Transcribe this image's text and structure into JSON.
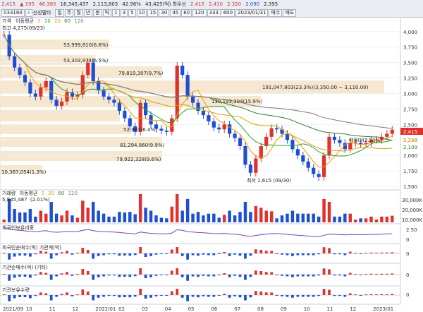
{
  "toolbar": {
    "row1": {
      "price": "2,415",
      "change": "▲ 195",
      "pct": "46.385",
      "vol": "16,345,437",
      "amount": "2,113,803",
      "ratio": "42.96%",
      "tail": "43,425(억) 최우선",
      "bid": "2.415",
      "ask": "2.410",
      "high": "2.320",
      "low": "2.090",
      "last": "2.395",
      "buttons": [
        "일",
        "주",
        "월",
        "년",
        "분",
        "틱"
      ],
      "periods": [
        "1",
        "3",
        "5",
        "10",
        "15",
        "30",
        "45",
        "60",
        "120"
      ],
      "count": "333 / 600",
      "date": "2023/01/31",
      "zoom_buttons": [
        "매수",
        "매도"
      ]
    },
    "row2": {
      "code": "033160",
      "name": "신성델타",
      "labels": [
        "삼성",
        "화",
        "분석"
      ]
    }
  },
  "legend": {
    "price": "가격",
    "ma_label": "이동평균",
    "ma_periods": [
      "5",
      "10",
      "20",
      "60",
      "120"
    ],
    "high_note": "최고 4,275(09/23)"
  },
  "annotations": [
    "53,999,810(6.6%)",
    "53,303,974(6.5%)",
    "79,819,307(9.7%)",
    "191,047,803(23.3%)(3,350.00 ~ 3,110.00)",
    "130,193,304(15.9%)",
    "81,294,860(9.9%)",
    "79,922,328(9.6%)",
    "10,367,054(1.3%)",
    "최저 1,615 (09/30)",
    "52,891(6.4%)",
    "매물대(2.50%)"
  ],
  "price_scale": [
    "4,000",
    "3,750",
    "3,500",
    "3,250",
    "3,000",
    "2,750",
    "2,500",
    "2,250",
    "2,000",
    "1,750",
    "1,500"
  ],
  "current_price_tag": "2,415",
  "ma_tags": [
    "2,256",
    "2,109"
  ],
  "volume_panel": {
    "label": "거래량",
    "ma_label": "이동평균",
    "ma_periods": [
      "5",
      "20",
      "60",
      "120"
    ],
    "value": "5,845,487",
    "pct": "(2.01%)",
    "scale": [
      "30,000K",
      "20,000K",
      "10,000K"
    ],
    "tag": "16,345K"
  },
  "indicator_panels": [
    {
      "label": "외국인보유비중",
      "scale": [
        "2.50",
        "0"
      ]
    },
    {
      "label": "외국인순매수(억) 기관계(억)",
      "scale": [
        "0"
      ]
    },
    {
      "label": "기관순매수(억) (기타)",
      "scale": [
        "0"
      ]
    },
    {
      "label": "기관보유수량",
      "scale": [
        "0"
      ]
    }
  ],
  "x_axis": [
    "2021/09",
    "10",
    "11",
    "12",
    "2022/01",
    "02",
    "03",
    "04",
    "05",
    "06",
    "07",
    "08",
    "09",
    "10",
    "11",
    "12",
    "2023/01"
  ],
  "colors": {
    "up": "#e0322d",
    "down": "#1f4fd1",
    "ma5": "#ff9900",
    "ma10": "#2ca02c",
    "ma20": "#d4a000",
    "ma60": "#2e7d32",
    "ma120": "#7a7a7a",
    "volume_band": "#f5e3c8"
  },
  "chart_data": {
    "type": "candlestick",
    "title": "",
    "x_label": "",
    "y_label": "",
    "y_range": [
      1500,
      4100
    ],
    "closes": [
      3950,
      3600,
      3420,
      3300,
      3180,
      3000,
      2950,
      3100,
      3200,
      2900,
      2800,
      2870,
      3020,
      2950,
      2980,
      3300,
      3500,
      3200,
      3050,
      2950,
      2900,
      2850,
      2720,
      2600,
      2470,
      2380,
      2850,
      2650,
      2500,
      2430,
      2400,
      2380,
      2600,
      3450,
      3300,
      2950,
      2850,
      2720,
      2650,
      2550,
      2450,
      2420,
      2500,
      2350,
      2280,
      2150,
      1850,
      1720,
      1950,
      2150,
      2300,
      2440,
      2420,
      2350,
      2250,
      2100,
      2000,
      1900,
      1800,
      1700,
      1650,
      2000,
      2300,
      2250,
      2200,
      2100,
      2200,
      2200,
      2180,
      2200,
      2250,
      2250,
      2300,
      2350,
      2415
    ]
  }
}
